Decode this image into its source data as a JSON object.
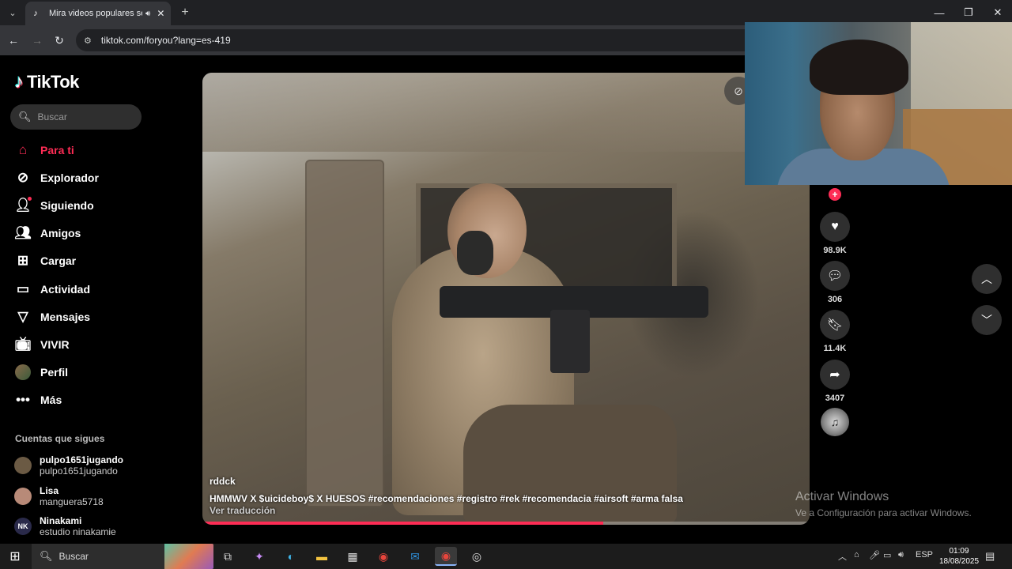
{
  "browser": {
    "tab_title": "Mira videos populares seleccionados para ti",
    "url": "tiktok.com/foryou?lang=es-419"
  },
  "sidebar": {
    "logo_text": "TikTok",
    "search_placeholder": "Buscar",
    "nav": [
      {
        "label": "Para ti",
        "icon": "home-icon",
        "active": true
      },
      {
        "label": "Explorador",
        "icon": "compass-icon"
      },
      {
        "label": "Siguiendo",
        "icon": "following-icon"
      },
      {
        "label": "Amigos",
        "icon": "friends-icon"
      },
      {
        "label": "Cargar",
        "icon": "upload-icon"
      },
      {
        "label": "Actividad",
        "icon": "activity-icon"
      },
      {
        "label": "Mensajes",
        "icon": "messages-icon"
      },
      {
        "label": "VIVIR",
        "icon": "live-icon"
      },
      {
        "label": "Perfil",
        "icon": "avatar"
      },
      {
        "label": "Más",
        "icon": "more-icon"
      }
    ],
    "following_title": "Cuentas que sigues",
    "following": [
      {
        "name": "pulpo1651jugando",
        "handle": "pulpo1651jugando",
        "avatar_color": "#6b5a44",
        "initials": ""
      },
      {
        "name": "Lisa",
        "handle": "manguera5718",
        "avatar_color": "#b88a78",
        "initials": ""
      },
      {
        "name": "Ninakami",
        "handle": "estudio ninakamie",
        "avatar_color": "#2a2a4a",
        "initials": "NK"
      }
    ]
  },
  "video": {
    "author": "rddck",
    "caption": "HMMWV X $uicideboy$ X HUESOS #recomendaciones #registro #rek #recomendacia #airsoft #arma falsa",
    "translate": "Ver traducción",
    "progress": 0.66
  },
  "actions": {
    "likes": "98.9K",
    "comments": "306",
    "saves": "11.4K",
    "shares": "3407"
  },
  "watermark": {
    "title": "Activar Windows",
    "subtitle": "Ve a Configuración para activar Windows."
  },
  "taskbar": {
    "search_text": "Buscar",
    "lang": "ESP",
    "time": "01:09",
    "date": "18/08/2025"
  },
  "colors": {
    "accent": "#fe2c55",
    "background": "#000000"
  }
}
